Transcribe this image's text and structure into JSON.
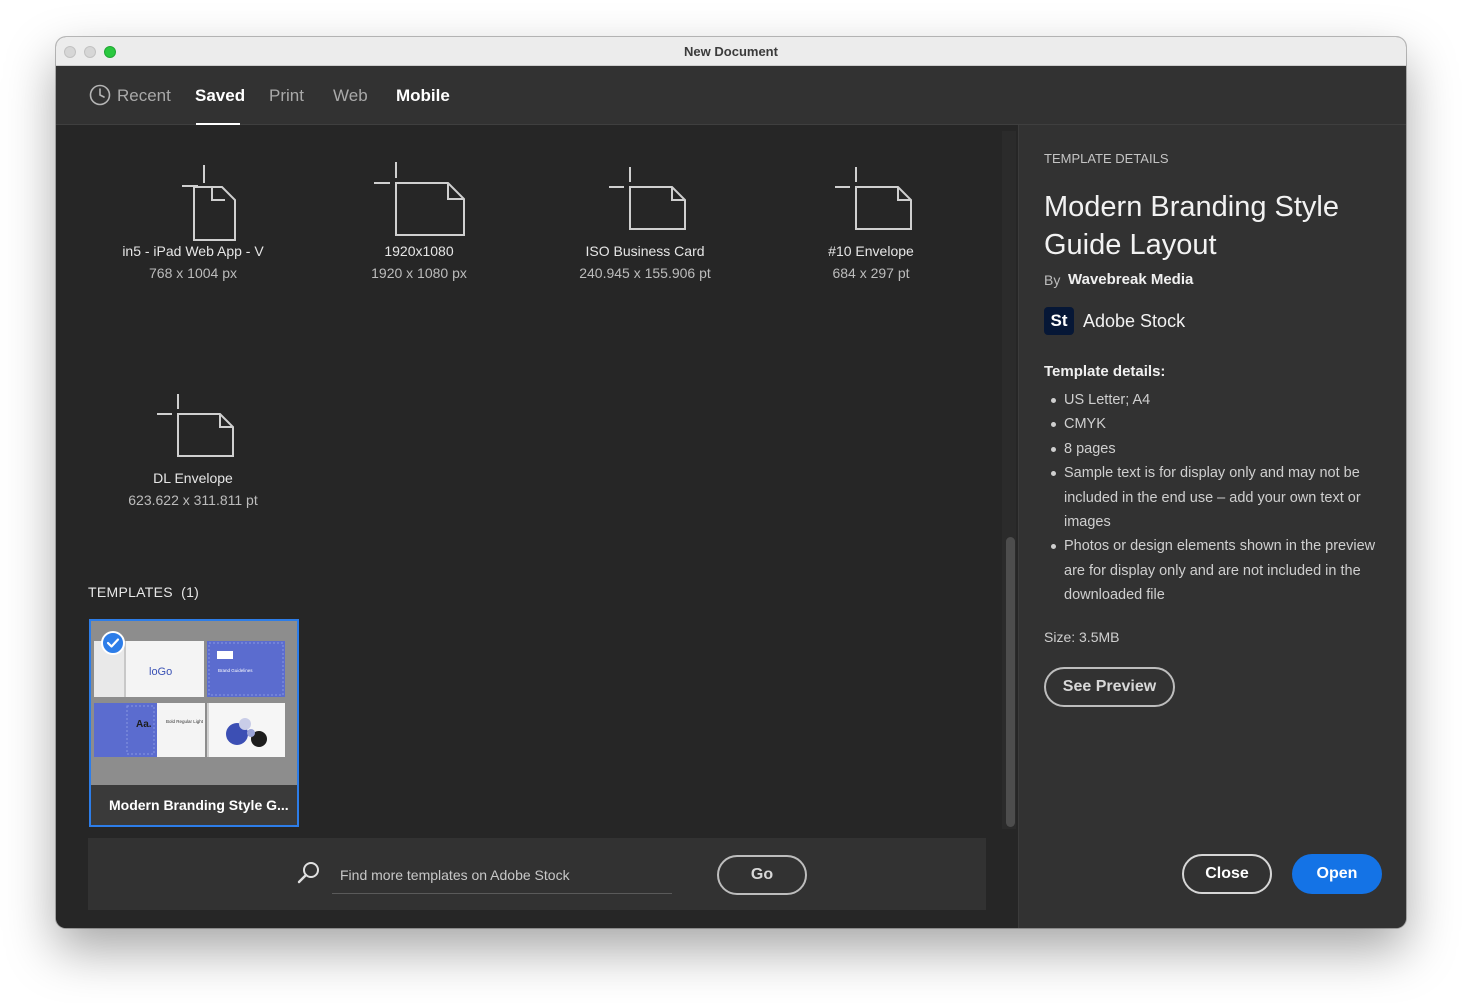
{
  "window": {
    "title": "New Document"
  },
  "tabs": [
    {
      "label": "Recent",
      "icon": "clock-icon"
    },
    {
      "label": "Saved",
      "active": true
    },
    {
      "label": "Print"
    },
    {
      "label": "Web"
    },
    {
      "label": "Mobile"
    }
  ],
  "presets": [
    {
      "name": "in5 - iPad Web App - V",
      "size": "768 x 1004 px",
      "orientation": "portrait"
    },
    {
      "name": "1920x1080",
      "size": "1920 x 1080 px",
      "orientation": "landscape"
    },
    {
      "name": "ISO Business Card",
      "size": "240.945 x 155.906 pt",
      "orientation": "landscape"
    },
    {
      "name": "#10 Envelope",
      "size": "684 x 297 pt",
      "orientation": "landscape"
    },
    {
      "name": "DL Envelope",
      "size": "623.622 x 311.811 pt",
      "orientation": "landscape"
    }
  ],
  "templates": {
    "heading": "TEMPLATES",
    "count": "(1)",
    "items": [
      {
        "caption": "Modern Branding Style G...",
        "selected": true,
        "thumb_text": {
          "logo": "loGo",
          "brand": "Brand Guidelines",
          "aa": "Aa.",
          "weights": "Bold Regular Light"
        }
      }
    ]
  },
  "search": {
    "placeholder": "Find more templates on Adobe Stock",
    "go_label": "Go"
  },
  "details": {
    "heading": "TEMPLATE DETAILS",
    "title": "Modern Branding Style Guide Layout",
    "by_label": "By",
    "author": "Wavebreak Media",
    "source_logo": "St",
    "source": "Adobe Stock",
    "list_heading": "Template details:",
    "items": [
      "US Letter; A4",
      "CMYK",
      "8 pages",
      "Sample text is for display only and may not be included in the end use – add your own text or images",
      "Photos or design elements shown in the preview are for display only and are not included in the downloaded file"
    ],
    "size_label": "Size:  3.5MB",
    "see_preview_label": "See Preview"
  },
  "footer": {
    "close_label": "Close",
    "open_label": "Open"
  },
  "colors": {
    "accent": "#1473e6",
    "background": "#262626",
    "panel": "#323232"
  }
}
